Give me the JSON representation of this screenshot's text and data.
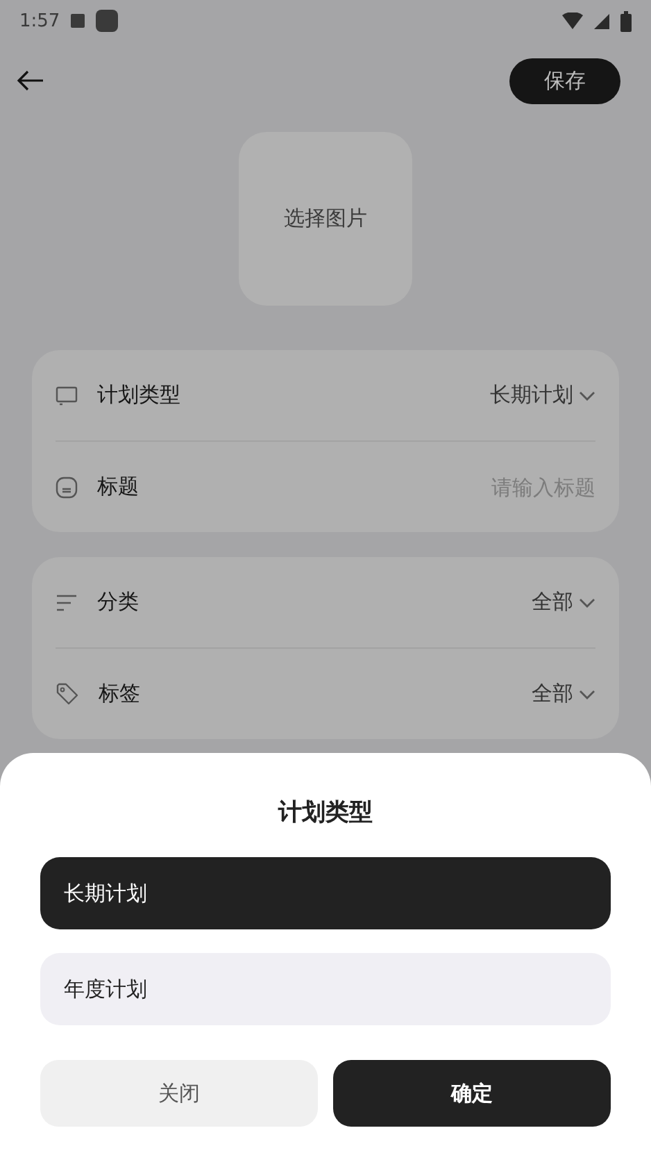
{
  "status_bar": {
    "time": "1:57"
  },
  "header": {
    "save_button": "保存"
  },
  "image_picker": {
    "label": "选择图片"
  },
  "form_groups": [
    {
      "rows": [
        {
          "kind": "select",
          "label": "计划类型",
          "value": "长期计划"
        },
        {
          "kind": "input",
          "label": "标题",
          "placeholder": "请输入标题"
        }
      ]
    },
    {
      "rows": [
        {
          "kind": "select",
          "label": "分类",
          "value": "全部"
        },
        {
          "kind": "select",
          "label": "标签",
          "value": "全部"
        }
      ]
    }
  ],
  "sheet": {
    "title": "计划类型",
    "options": [
      {
        "label": "长期计划",
        "selected": true
      },
      {
        "label": "年度计划",
        "selected": false
      }
    ],
    "close_button": "关闭",
    "confirm_button": "确定"
  }
}
